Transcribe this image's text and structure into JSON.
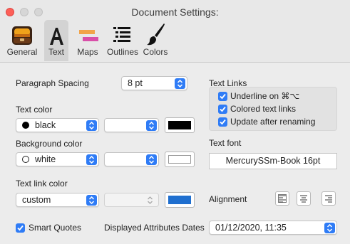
{
  "window": {
    "title": "Document Settings:"
  },
  "toolbar": {
    "tabs": [
      {
        "label": "General",
        "icon": "general-icon"
      },
      {
        "label": "Text",
        "icon": "text-icon",
        "active": true
      },
      {
        "label": "Maps",
        "icon": "maps-icon"
      },
      {
        "label": "Outlines",
        "icon": "outlines-icon"
      },
      {
        "label": "Colors",
        "icon": "colors-icon"
      }
    ]
  },
  "paragraph": {
    "label": "Paragraph Spacing",
    "value": "8 pt"
  },
  "text_color": {
    "label": "Text color",
    "value": "black",
    "swatch": "#000000"
  },
  "background_color": {
    "label": "Background color",
    "value": "white",
    "swatch": "#ffffff"
  },
  "link_color": {
    "label": "Text link color",
    "value": "custom",
    "swatch": "#1f6fcf"
  },
  "text_links": {
    "label": "Text Links",
    "options": [
      {
        "label": "Underline on ⌘⌥",
        "checked": true
      },
      {
        "label": "Colored text links",
        "checked": true
      },
      {
        "label": "Update after renaming",
        "checked": true
      }
    ]
  },
  "text_font": {
    "label": "Text font",
    "value": "MercurySSm-Book 16pt"
  },
  "alignment": {
    "label": "Alignment"
  },
  "smart_quotes": {
    "label": "Smart Quotes",
    "checked": true
  },
  "dates": {
    "label": "Displayed Attributes Dates",
    "value": "01/12/2020, 11:35"
  },
  "colors": {
    "accent": "#2f7cf6"
  }
}
